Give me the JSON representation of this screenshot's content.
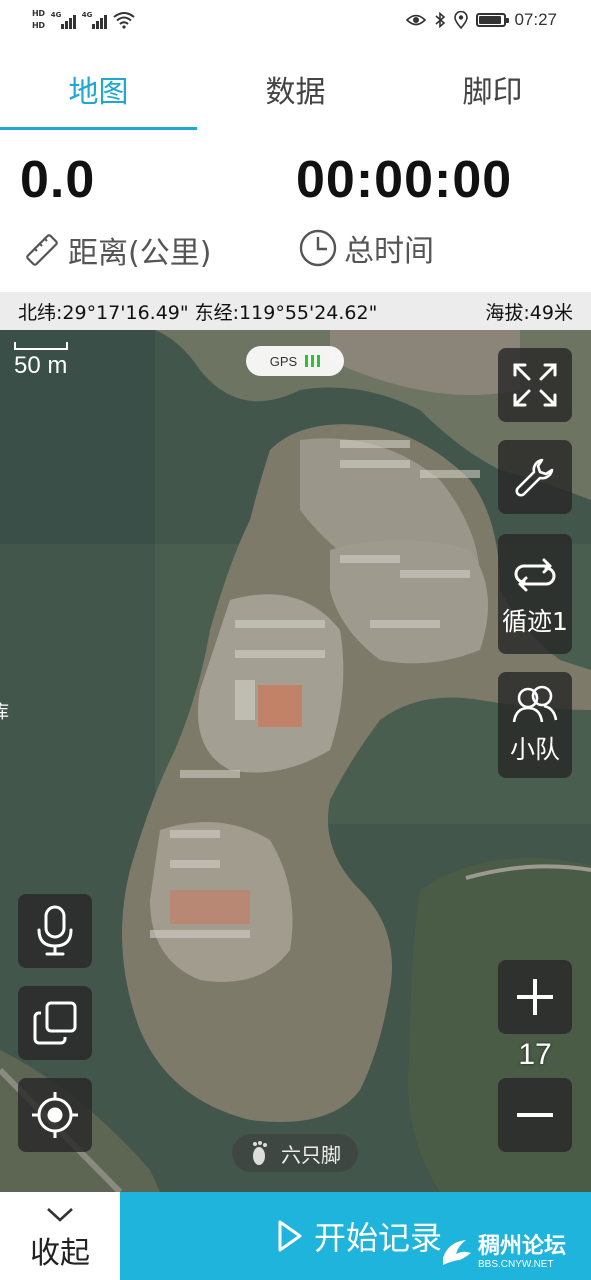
{
  "status_bar": {
    "hd_top": "HD",
    "hd_bottom": "HD",
    "net1": "4G",
    "net2": "4G",
    "time": "07:27",
    "battery_level": 0.9
  },
  "tabs": [
    {
      "label": "地图",
      "active": true
    },
    {
      "label": "数据",
      "active": false
    },
    {
      "label": "脚印",
      "active": false
    }
  ],
  "stats": {
    "distance_value": "0.0",
    "distance_label": "距离(公里)",
    "time_value": "00:00:00",
    "time_label": "总时间"
  },
  "coords": {
    "position": "北纬:29°17'16.49\" 东经:119°55'24.62\"",
    "altitude": "海拔:49米"
  },
  "map": {
    "scale_label": "50 m",
    "gps_label": "GPS",
    "track_button_label": "循迹1",
    "team_button_label": "小队",
    "zoom_level": "17",
    "watermark": "六只脚",
    "edge_char": "库"
  },
  "bottom": {
    "collapse_label": "收起",
    "record_label": "开始记录"
  },
  "forum_watermark": {
    "name": "稠州论坛",
    "url": "BBS.CNYW.NET"
  },
  "colors": {
    "accent": "#1fa8d4",
    "record_button": "#1fb4dc",
    "gps_ok": "#2fbf3a"
  }
}
